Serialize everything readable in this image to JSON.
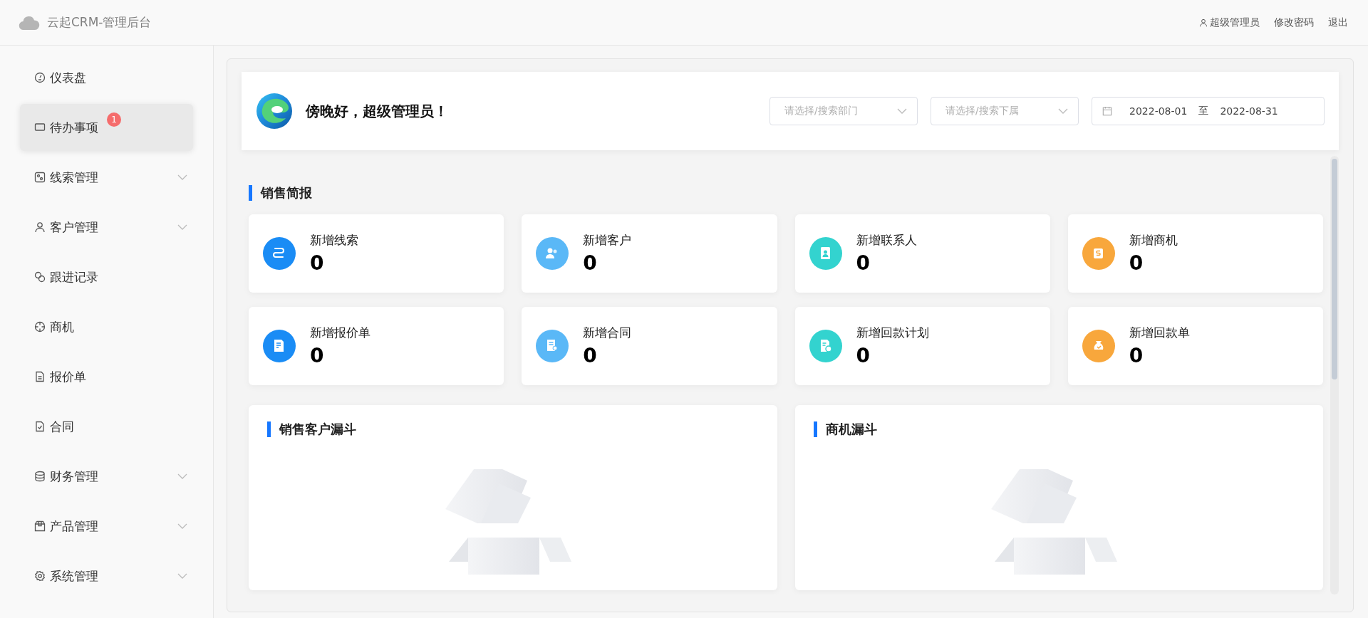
{
  "header": {
    "title": "云起CRM-管理后台",
    "user": "超级管理员",
    "links": [
      "修改密码",
      "退出"
    ]
  },
  "sidebar": {
    "items": [
      {
        "label": "仪表盘",
        "kind": "link",
        "selected": false
      },
      {
        "label": "待办事项",
        "kind": "link",
        "selected": true,
        "badge": "1"
      },
      {
        "label": "线索管理",
        "kind": "group",
        "selected": false
      },
      {
        "label": "客户管理",
        "kind": "group",
        "selected": false
      },
      {
        "label": "跟进记录",
        "kind": "link",
        "selected": false
      },
      {
        "label": "商机",
        "kind": "link",
        "selected": false
      },
      {
        "label": "报价单",
        "kind": "link",
        "selected": false
      },
      {
        "label": "合同",
        "kind": "link",
        "selected": false
      },
      {
        "label": "财务管理",
        "kind": "group",
        "selected": false
      },
      {
        "label": "产品管理",
        "kind": "group",
        "selected": false
      },
      {
        "label": "系统管理",
        "kind": "group",
        "selected": false
      }
    ]
  },
  "greeting": {
    "text": "傍晚好，超级管理员！",
    "department": {
      "placeholder": "请选择/搜索部门"
    },
    "subordinate": {
      "placeholder": "请选择/搜索下属"
    },
    "date_range": {
      "start": "2022-08-01",
      "separator": "至",
      "end": "2022-08-31"
    }
  },
  "sales_brief": {
    "title": "销售简报",
    "stats": [
      {
        "label": "新增线索",
        "value": "0",
        "color": "#1a8cf5"
      },
      {
        "label": "新增客户",
        "value": "0",
        "color": "#5ab8f7"
      },
      {
        "label": "新增联系人",
        "value": "0",
        "color": "#33d3cf"
      },
      {
        "label": "新增商机",
        "value": "0",
        "color": "#f8a73c"
      },
      {
        "label": "新增报价单",
        "value": "0",
        "color": "#1a8cf5"
      },
      {
        "label": "新增合同",
        "value": "0",
        "color": "#5ab8f7"
      },
      {
        "label": "新增回款计划",
        "value": "0",
        "color": "#33d3cf"
      },
      {
        "label": "新增回款单",
        "value": "0",
        "color": "#f8a73c"
      }
    ]
  },
  "funnels": [
    {
      "title": "销售客户漏斗"
    },
    {
      "title": "商机漏斗"
    }
  ]
}
